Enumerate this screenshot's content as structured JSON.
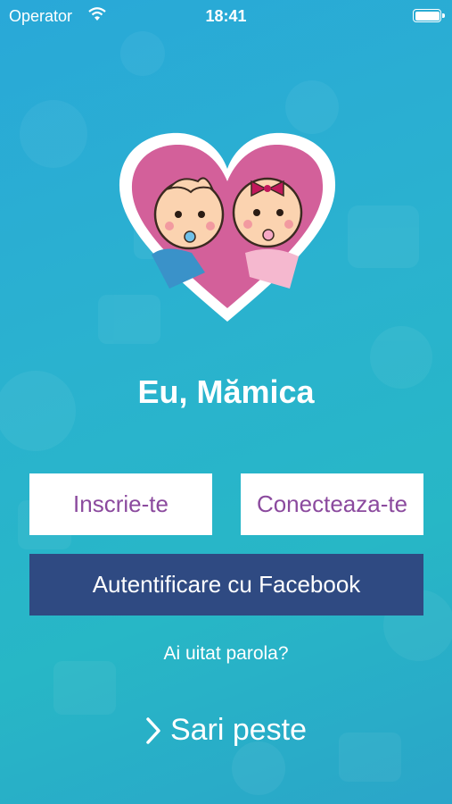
{
  "status_bar": {
    "carrier": "Operator",
    "time": "18:41",
    "wifi_icon": "wifi-icon",
    "battery_icon": "battery-icon"
  },
  "app": {
    "title": "Eu, Mămica",
    "logo_icon": "heart-babies-logo"
  },
  "buttons": {
    "signup_label": "Inscrie-te",
    "login_label": "Conecteaza-te",
    "facebook_label": "Autentificare cu Facebook",
    "forgot_label": "Ai uitat parola?",
    "skip_label": "Sari peste",
    "skip_icon": "chevron-right-icon"
  },
  "colors": {
    "background": "#29a8d8",
    "button_text": "#8b4a9e",
    "facebook": "#2f4a82",
    "heart": "#d3609a"
  }
}
